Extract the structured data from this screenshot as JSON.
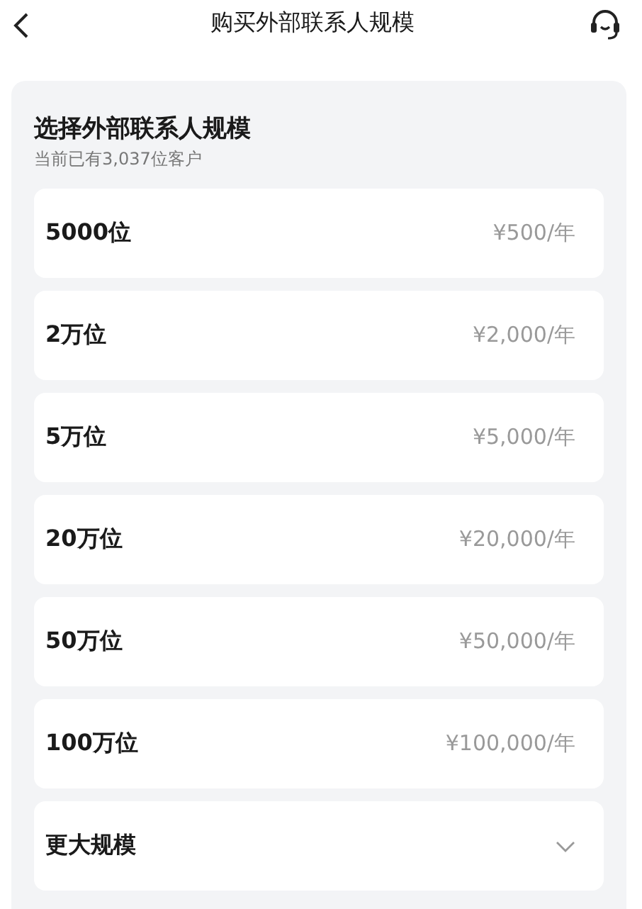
{
  "header": {
    "title": "购买外部联系人规模"
  },
  "panel": {
    "title": "选择外部联系人规模",
    "subtitle": "当前已有3,037位客户"
  },
  "options": [
    {
      "kind": "price",
      "label": "5000位",
      "price": "¥500/年"
    },
    {
      "kind": "price",
      "label": "2万位",
      "price": "¥2,000/年"
    },
    {
      "kind": "price",
      "label": "5万位",
      "price": "¥5,000/年"
    },
    {
      "kind": "price",
      "label": "20万位",
      "price": "¥20,000/年"
    },
    {
      "kind": "price",
      "label": "50万位",
      "price": "¥50,000/年"
    },
    {
      "kind": "price",
      "label": "100万位",
      "price": "¥100,000/年"
    },
    {
      "kind": "expand",
      "label": "更大规模"
    }
  ]
}
